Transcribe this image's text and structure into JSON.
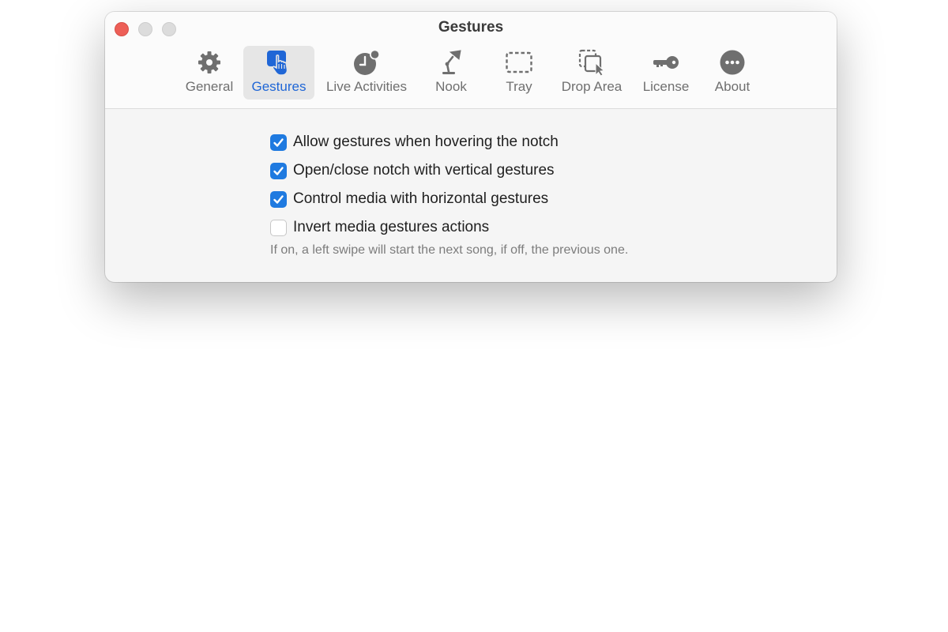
{
  "window": {
    "title": "Gestures"
  },
  "toolbar": {
    "tabs": [
      {
        "label": "General",
        "icon": "gear-icon",
        "selected": false
      },
      {
        "label": "Gestures",
        "icon": "hand-tap-icon",
        "selected": true
      },
      {
        "label": "Live Activities",
        "icon": "clock-badge-icon",
        "selected": false
      },
      {
        "label": "Nook",
        "icon": "desk-lamp-icon",
        "selected": false
      },
      {
        "label": "Tray",
        "icon": "dashed-rectangle-icon",
        "selected": false
      },
      {
        "label": "Drop Area",
        "icon": "dashed-square-cursor-icon",
        "selected": false
      },
      {
        "label": "License",
        "icon": "key-icon",
        "selected": false
      },
      {
        "label": "About",
        "icon": "ellipsis-circle-icon",
        "selected": false
      }
    ]
  },
  "options": [
    {
      "label": "Allow gestures when hovering the notch",
      "checked": true
    },
    {
      "label": "Open/close notch with vertical gestures",
      "checked": true
    },
    {
      "label": "Control media with horizontal gestures",
      "checked": true
    },
    {
      "label": "Invert media gestures actions",
      "checked": false
    }
  ],
  "invert_note": "If on, a left swipe will start the next song, if off, the previous one.",
  "colors": {
    "accent": "#1f7ae0",
    "selected_tab_text": "#1f66d6",
    "close_button": "#ed5f57"
  }
}
